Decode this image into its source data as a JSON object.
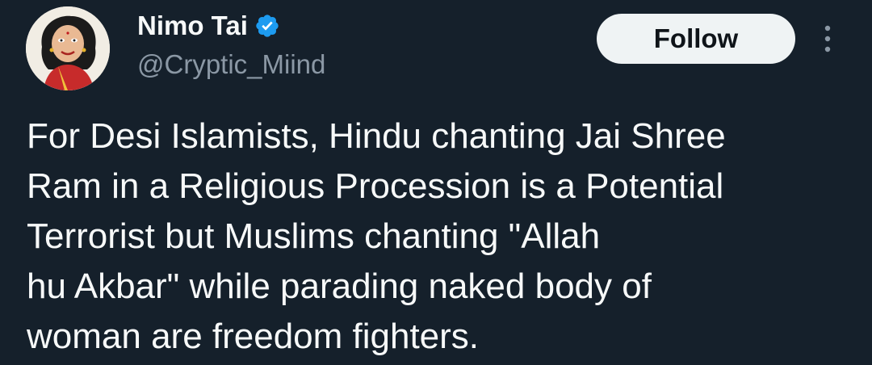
{
  "tweet": {
    "author": {
      "display_name": "Nimo Tai",
      "handle": "@Cryptic_Miind",
      "verified_icon": "verified-badge-icon",
      "verified_color": "#1d9bf0"
    },
    "follow_label": "Follow",
    "more_icon": "more-vertical-icon",
    "text_lines": [
      "For Desi Islamists, Hindu chanting Jai Shree",
      "Ram in a Religious Procession is a Potential",
      "Terrorist but Muslims chanting \"Allah",
      "hu Akbar\" while parading naked body of",
      "woman are freedom fighters."
    ]
  },
  "theme": {
    "background": "#15202b",
    "text": "#f7f9f9",
    "secondary_text": "#8b98a5",
    "button_bg": "#eff3f4",
    "button_text": "#0f1419"
  }
}
